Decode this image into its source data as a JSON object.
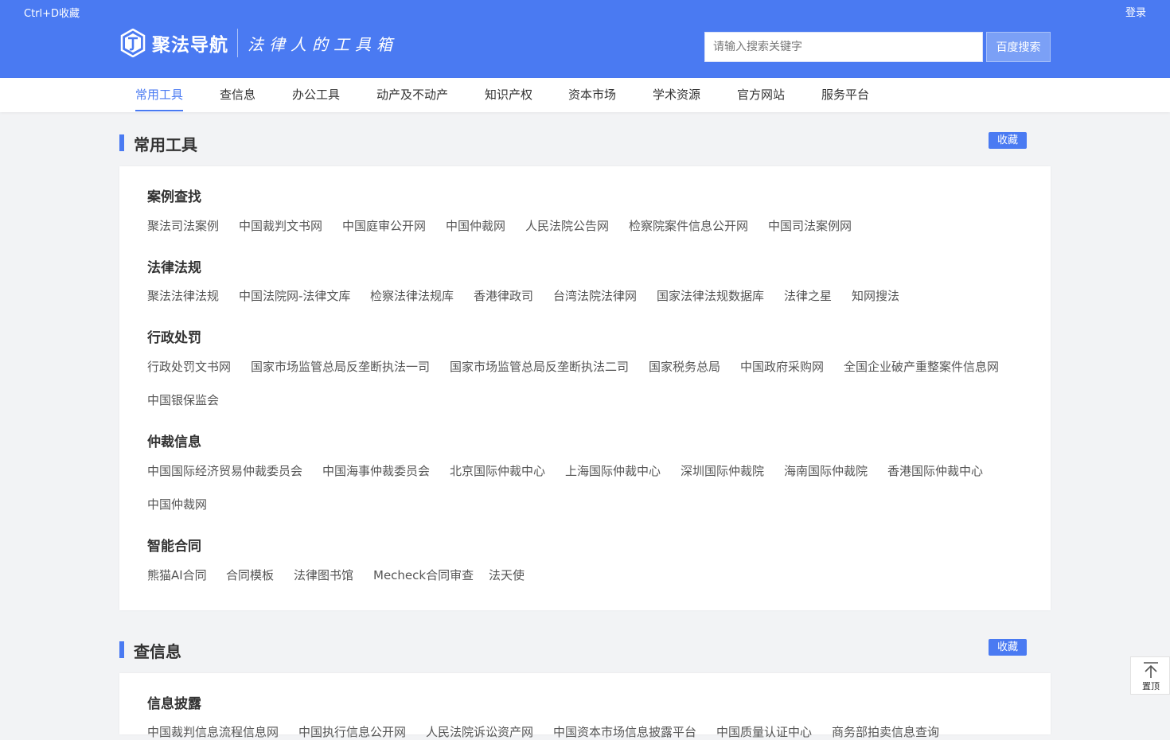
{
  "header": {
    "bookmark_hint": "Ctrl+D收藏",
    "login": "登录",
    "site_name": "聚法导航",
    "slogan": "法律人的工具箱",
    "search_placeholder": "请输入搜索关键字",
    "search_button": "百度搜索"
  },
  "nav": {
    "tabs": [
      {
        "label": "常用工具",
        "active": true
      },
      {
        "label": "查信息"
      },
      {
        "label": "办公工具"
      },
      {
        "label": "动产及不动产"
      },
      {
        "label": "知识产权"
      },
      {
        "label": "资本市场"
      },
      {
        "label": "学术资源"
      },
      {
        "label": "官方网站"
      },
      {
        "label": "服务平台"
      }
    ]
  },
  "sections": [
    {
      "title": "常用工具",
      "fav": "收藏",
      "categories": [
        {
          "title": "案例查找",
          "links": [
            "聚法司法案例",
            "中国裁判文书网",
            "中国庭审公开网",
            "中国仲裁网",
            "人民法院公告网",
            "检察院案件信息公开网",
            "中国司法案例网"
          ]
        },
        {
          "title": "法律法规",
          "links": [
            "聚法法律法规",
            "中国法院网-法律文库",
            "检察法律法规库",
            "香港律政司",
            "台湾法院法律网",
            "国家法律法规数据库",
            "法律之星",
            "知网搜法"
          ]
        },
        {
          "title": "行政处罚",
          "links": [
            "行政处罚文书网",
            "国家市场监管总局反垄断执法一司",
            "国家市场监管总局反垄断执法二司",
            "国家税务总局",
            "中国政府采购网",
            "全国企业破产重整案件信息网",
            "中国银保监会"
          ]
        },
        {
          "title": "仲裁信息",
          "links": [
            "中国国际经济贸易仲裁委员会",
            "中国海事仲裁委员会",
            "北京国际仲裁中心",
            "上海国际仲裁中心",
            "深圳国际仲裁院",
            "海南国际仲裁院",
            "香港国际仲裁中心",
            "中国仲裁网"
          ]
        },
        {
          "title": "智能合同",
          "links": [
            "熊猫AI合同",
            "合同模板",
            "法律图书馆",
            "Mecheck合同审查",
            "法天使"
          ]
        }
      ]
    },
    {
      "title": "查信息",
      "fav": "收藏",
      "categories": [
        {
          "title": "信息披露",
          "links": [
            "中国裁判信息流程信息网",
            "中国执行信息公开网",
            "人民法院诉讼资产网",
            "中国资本市场信息披露平台",
            "中国质量认证中心",
            "商务部拍卖信息查询"
          ]
        }
      ]
    }
  ],
  "back_to_top": "置顶",
  "colors": {
    "brand": "#4a7af2",
    "page_bg": "#f2f3f5"
  }
}
